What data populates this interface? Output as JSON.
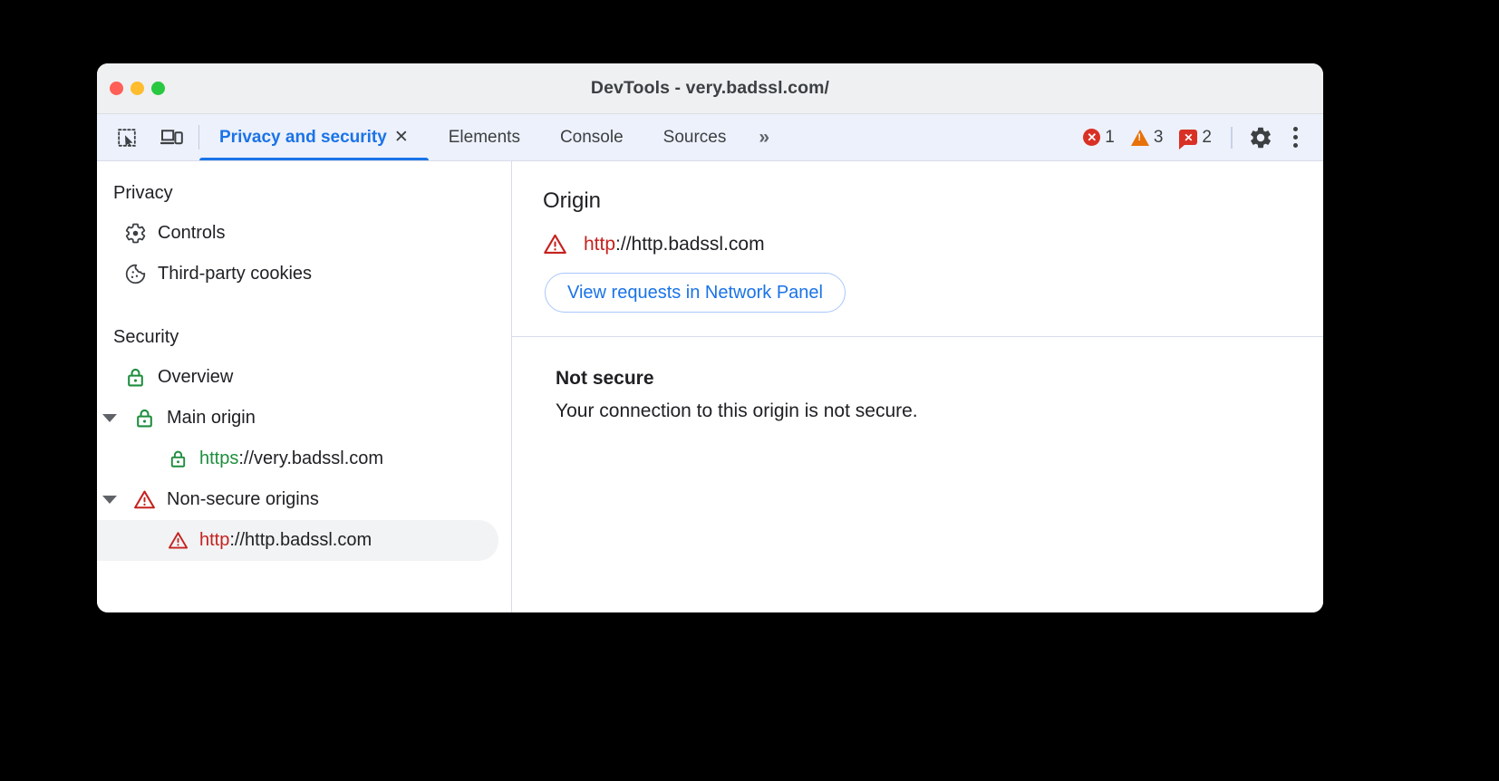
{
  "window": {
    "title": "DevTools - very.badssl.com/",
    "traffic_lights": [
      "close",
      "minimize",
      "maximize"
    ]
  },
  "toolbar": {
    "inspect_icon": "inspect-element-icon",
    "device_icon": "device-toolbar-icon",
    "overflow_label": "»",
    "settings_icon": "gear-icon",
    "more_icon": "kebab-menu-icon",
    "counters": [
      {
        "name": "errors",
        "icon": "error-circle-icon",
        "value": "1",
        "color": "#d93025"
      },
      {
        "name": "warnings",
        "icon": "warning-triangle-icon",
        "value": "3",
        "color": "#e8710a"
      },
      {
        "name": "issues",
        "icon": "issue-bubble-icon",
        "value": "2",
        "color": "#d93025"
      }
    ]
  },
  "tabs": [
    {
      "label": "Privacy and security",
      "active": true,
      "closable": true,
      "close_glyph": "✕"
    },
    {
      "label": "Elements",
      "active": false,
      "closable": false
    },
    {
      "label": "Console",
      "active": false,
      "closable": false
    },
    {
      "label": "Sources",
      "active": false,
      "closable": false
    }
  ],
  "sidebar": {
    "groups": [
      {
        "title": "Privacy",
        "items": [
          {
            "label": "Controls",
            "icon": "gear-icon",
            "icon_color": "#3c4043",
            "indent": 1
          },
          {
            "label": "Third-party cookies",
            "icon": "cookie-icon",
            "icon_color": "#3c4043",
            "indent": 1
          }
        ]
      },
      {
        "title": "Security",
        "items": [
          {
            "label": "Overview",
            "icon": "lock-icon",
            "icon_color": "#1e8e3e",
            "indent": 1,
            "twisty": false
          },
          {
            "label": "Main origin",
            "icon": "lock-icon",
            "icon_color": "#1e8e3e",
            "indent": 1,
            "twisty": true
          },
          {
            "scheme": "https",
            "rest": "://very.badssl.com",
            "icon": "lock-icon",
            "icon_color": "#1e8e3e",
            "indent": 2,
            "scheme_color": "#1e8e3e",
            "selected": false
          },
          {
            "label": "Non-secure origins",
            "icon": "warning-triangle-icon",
            "icon_color": "#c5221f",
            "indent": 1,
            "twisty": true
          },
          {
            "scheme": "http",
            "rest": "://http.badssl.com",
            "icon": "warning-triangle-icon",
            "icon_color": "#c5221f",
            "indent": 2,
            "scheme_color": "#c5221f",
            "selected": true
          }
        ]
      }
    ]
  },
  "main": {
    "origin_section": {
      "title": "Origin",
      "origin_icon": "warning-triangle-icon",
      "origin_scheme": "http",
      "origin_rest": "://http.badssl.com",
      "button_label": "View requests in Network Panel"
    },
    "state_section": {
      "title": "Not secure",
      "description": "Your connection to this origin is not secure."
    }
  },
  "colors": {
    "accent": "#1a73e8",
    "secure_green": "#1e8e3e",
    "insecure_red": "#c5221f",
    "error_red": "#d93025",
    "warning_orange": "#e8710a"
  }
}
